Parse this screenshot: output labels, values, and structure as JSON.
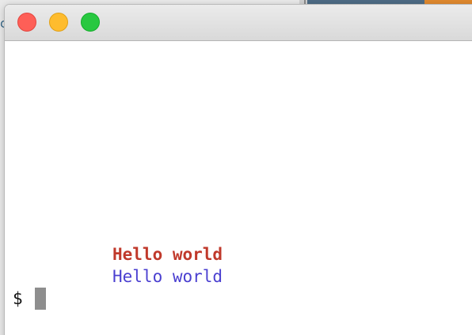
{
  "window": {
    "controls": [
      {
        "name": "close",
        "color": "#fe5f57"
      },
      {
        "name": "minimize",
        "color": "#febc2e"
      },
      {
        "name": "zoom",
        "color": "#28c840"
      }
    ]
  },
  "terminal": {
    "output_lines": [
      {
        "text": "Hello world",
        "color": "#c0392b",
        "style": "bold"
      },
      {
        "text": "Hello world",
        "color": "#4a3fd0",
        "style": "regular"
      }
    ],
    "prompt": "$"
  },
  "background": {
    "left_glyph": "c"
  }
}
